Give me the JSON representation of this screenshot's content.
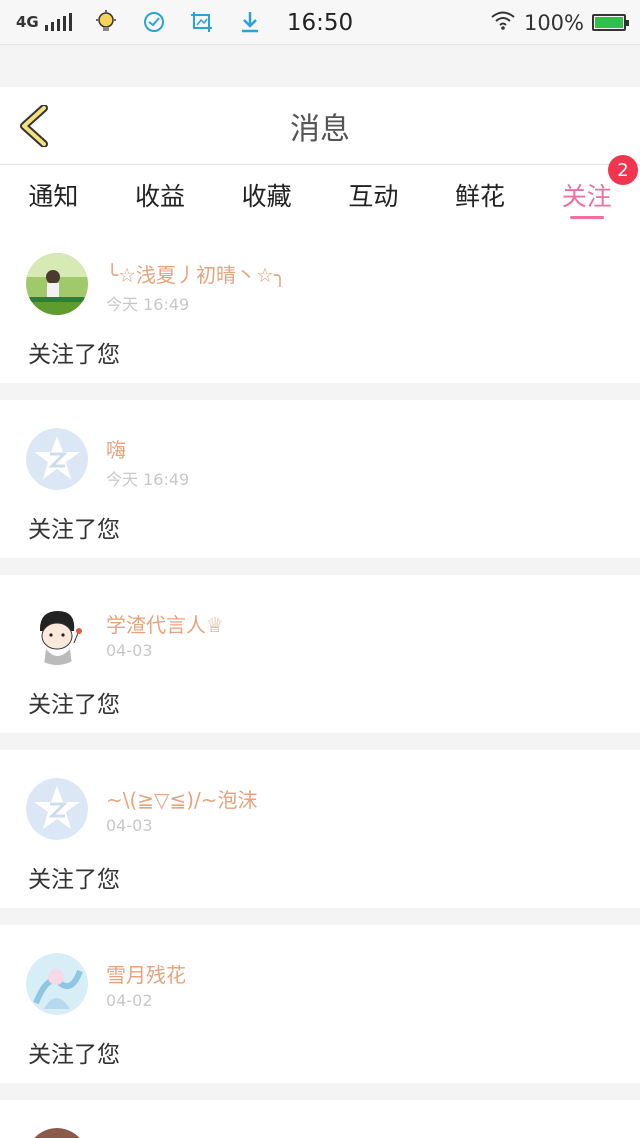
{
  "status_bar": {
    "network": "4G",
    "time": "16:50",
    "battery": "100%"
  },
  "header": {
    "title": "消息"
  },
  "tabs": [
    {
      "label": "通知"
    },
    {
      "label": "收益"
    },
    {
      "label": "收藏"
    },
    {
      "label": "互动"
    },
    {
      "label": "鲜花"
    },
    {
      "label": "关注",
      "active": true,
      "badge": "2"
    }
  ],
  "colors": {
    "accent": "#ef6fa0",
    "username": "#e8a37c",
    "badge": "#f0354f"
  },
  "items": [
    {
      "username": "╰☆浅夏丿初晴丶☆╮",
      "time": "今天 16:49",
      "message": "关注了您",
      "avatar": "photo-avatar-girl"
    },
    {
      "username": "嗨",
      "time": "今天 16:49",
      "message": "关注了您",
      "avatar": "default-qq-avatar"
    },
    {
      "username": "学渣代言人♕",
      "time": "04-03",
      "message": "关注了您",
      "avatar": "cartoon-boy-avatar"
    },
    {
      "username": "~\\(≧▽≦)/~泡沫",
      "time": "04-03",
      "message": "关注了您",
      "avatar": "default-qq-avatar"
    },
    {
      "username": "雪月残花",
      "time": "04-02",
      "message": "关注了您",
      "avatar": "anime-girl-avatar"
    },
    {
      "username": "",
      "time": "",
      "message": "",
      "avatar": "photo-avatar"
    }
  ]
}
